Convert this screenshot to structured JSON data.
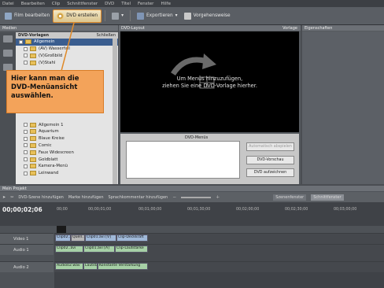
{
  "menubar": [
    "Datei",
    "Bearbeiten",
    "Clip",
    "Schnittfenster",
    "DVD",
    "Titel",
    "Fenster",
    "Hilfe"
  ],
  "toolbar": {
    "edit_label": "Film bearbeiten",
    "dvd_label": "DVD erstellen",
    "export_label": "Exportieren",
    "workflow_label": "Vorgehensweise"
  },
  "left_panel": {
    "title": "Medien",
    "list_title": "DVD-Vorlagen",
    "close": "Schließen",
    "items": [
      "Allgemein",
      "(AV) Wasserfall",
      "(V)Großbild",
      "(V)Stahl",
      "Allgemein 1",
      "Aquarium",
      "Blaue Kreise",
      "Comic",
      "Faux Widescreen",
      "Goldblatt",
      "Kamera-Menü",
      "Leinwand"
    ]
  },
  "center_panel": {
    "title": "DVD-Layout",
    "preset": "Vorlage",
    "hint_line1": "Um Menüs hinzuzufügen,",
    "hint_line2": "ziehen Sie eine DVD-Vorlage hierher.",
    "menus_label": "DVD-Menüs",
    "auto_button": "Automatisch abspielen",
    "preview_button": "DVD-Vorschau",
    "burn_button": "DVD aufzeichnen"
  },
  "right_panel": {
    "title": "Eigenschaften"
  },
  "callout": {
    "line1": "Hier kann man die",
    "line2": "DVD-Menüansicht",
    "line3": "auswählen."
  },
  "timeline": {
    "title": "Mein Projekt",
    "add_scene": "DVD-Szene hinzufügen",
    "add_marker": "Marke hinzufügen",
    "add_narration": "Sprachkommentar hinzufügen",
    "scene_window": "Szenenfenster",
    "timeline_label": "Schnittfenster",
    "timecode": "00;00;02;06",
    "ticks": [
      "00;00",
      "00;00;01;00",
      "00;00;02;00",
      "00;00;03;00",
      "00;01;00;00",
      "00;01;30;00",
      "00;02;00;00",
      "00;02;30;00",
      "00;03;00;00"
    ],
    "tracks": {
      "video1": "Video 1",
      "audio1": "Audio 1",
      "audio2": "Audio 2"
    },
    "clips": {
      "v1a": "Clip02..",
      "v1b": "Quell..",
      "v1c": "Clip01.avi [V]",
      "v1d": "Clip-Deckkraft",
      "a1a": "Clip02..avi",
      "a1b": "Clip01.avi [A]",
      "a1c": "Clip-Lautstärke",
      "a2a": "Audio02.wav",
      "a2b": "Lautstärke",
      "a2c": "Konstante Verstärkung"
    }
  },
  "colors": {
    "accent": "#e08a2a",
    "callout_bg": "#f3a35a",
    "stage": "#000000"
  }
}
